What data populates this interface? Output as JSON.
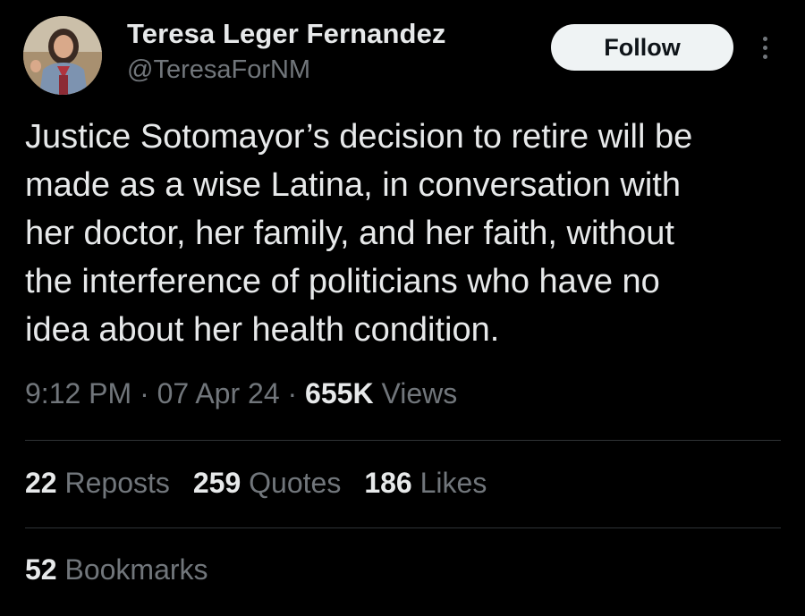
{
  "author": {
    "name": "Teresa Leger Fernandez",
    "handle": "@TeresaForNM",
    "avatar_icon": "profile-photo"
  },
  "actions": {
    "follow_label": "Follow",
    "more_icon": "more-vertical-icon"
  },
  "tweet": {
    "text": "Justice Sotomayor’s decision to retire will be\nmade as a wise Latina, in conversation with\nher doctor, her family, and her faith, without\nthe interference of politicians who have no\nidea about her health condition."
  },
  "meta": {
    "time": "9:12 PM",
    "separator1": " · ",
    "date": "07 Apr 24",
    "separator2": " · ",
    "views_count": "655K",
    "views_label": " Views"
  },
  "stats": {
    "reposts_count": "22",
    "reposts_label": " Reposts",
    "quotes_count": "259",
    "quotes_label": " Quotes",
    "likes_count": "186",
    "likes_label": " Likes",
    "bookmarks_count": "52",
    "bookmarks_label": " Bookmarks"
  },
  "colors": {
    "background": "#000000",
    "primary_text": "#e7e9ea",
    "secondary_text": "#71767b",
    "divider": "#2f3336",
    "follow_bg": "#eff3f4"
  }
}
